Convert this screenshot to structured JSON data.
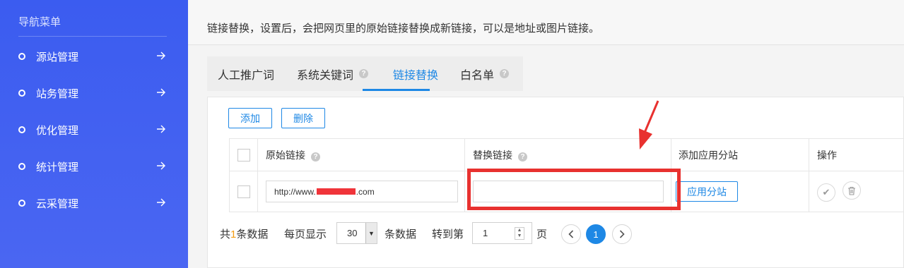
{
  "sidebar": {
    "title": "导航菜单",
    "items": [
      {
        "label": "源站管理"
      },
      {
        "label": "站务管理"
      },
      {
        "label": "优化管理"
      },
      {
        "label": "统计管理"
      },
      {
        "label": "云采管理"
      }
    ]
  },
  "main": {
    "description": "链接替换，设置后，会把网页里的原始链接替换成新链接，可以是地址或图片链接。",
    "tabs": [
      {
        "label": "人工推广词",
        "has_help": false,
        "active": false
      },
      {
        "label": "系统关键词",
        "has_help": true,
        "active": false
      },
      {
        "label": "链接替换",
        "has_help": false,
        "active": true
      },
      {
        "label": "白名单",
        "has_help": true,
        "active": false
      }
    ],
    "toolbar": {
      "add_label": "添加",
      "delete_label": "删除"
    },
    "table": {
      "headers": {
        "original": "原始链接",
        "replace": "替换链接",
        "apply": "添加应用分站",
        "action": "操作"
      },
      "row": {
        "original_prefix": "http://www.",
        "original_suffix": ".com",
        "replace_value": "",
        "apply_button": "应用分站"
      }
    },
    "pager": {
      "total_prefix": "共",
      "total_count": "1",
      "total_suffix": "条数据",
      "per_page_label": "每页显示",
      "per_page_value": "30",
      "per_page_suffix": "条数据",
      "goto_label": "转到第",
      "goto_value": "1",
      "goto_suffix": "页",
      "current_page": "1"
    }
  },
  "colors": {
    "sidebar": "#3b5cf0",
    "accent": "#1e88e5",
    "highlight": "#e8312f",
    "count": "#f39c12"
  }
}
